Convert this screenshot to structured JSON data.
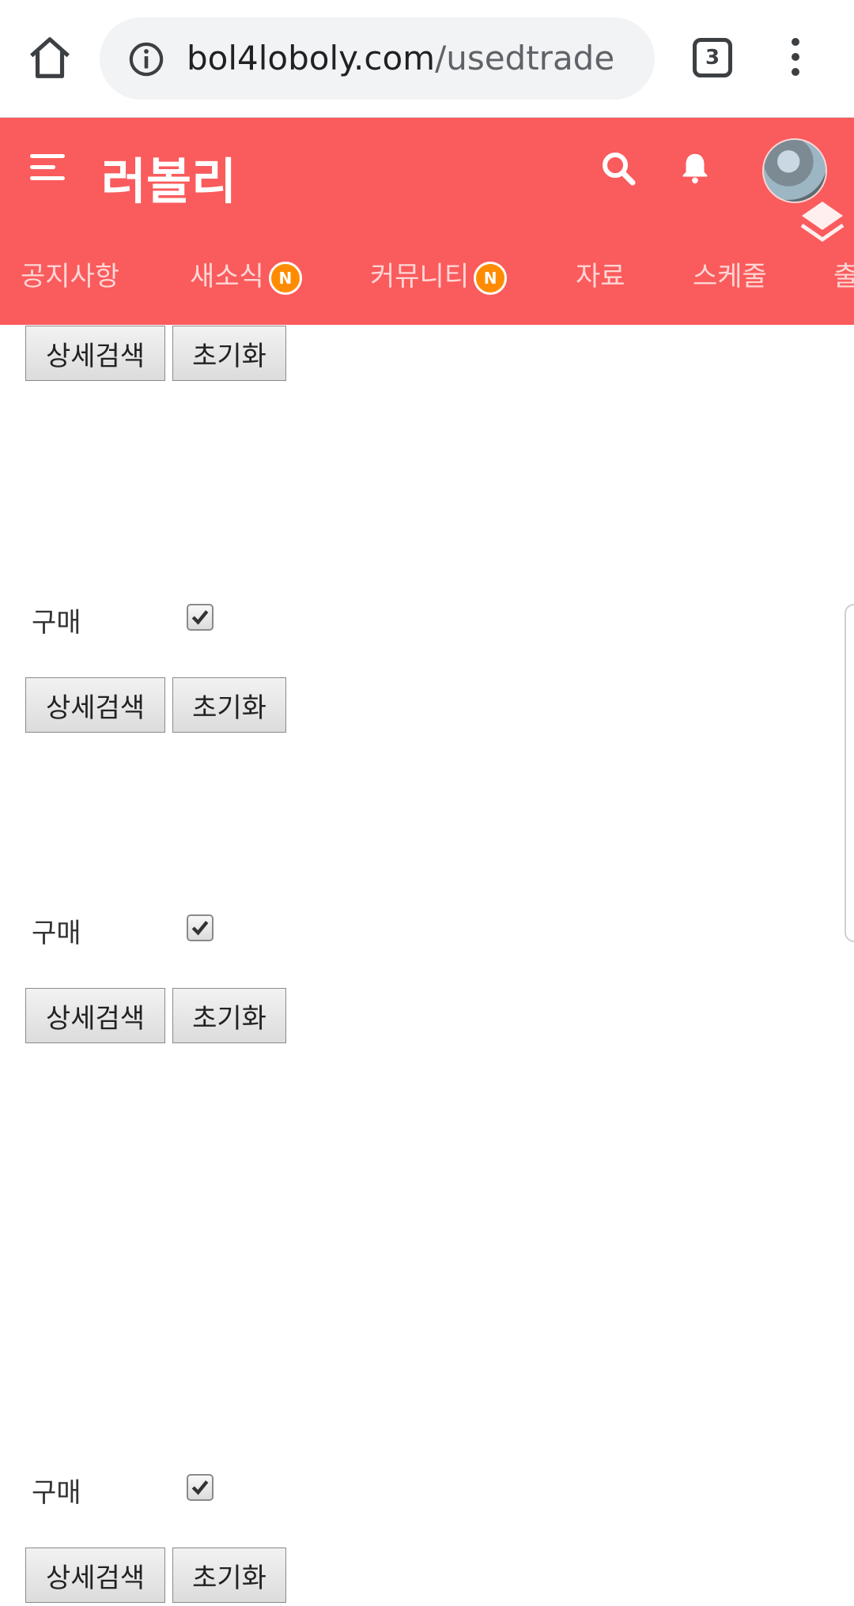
{
  "browser": {
    "url_domain": "bol4loboly.com",
    "url_path": "/usedtrade",
    "tab_count": "3"
  },
  "site": {
    "title": "러볼리",
    "nav": [
      {
        "label": "공지사항",
        "badge": ""
      },
      {
        "label": "새소식",
        "badge": "N"
      },
      {
        "label": "커뮤니티",
        "badge": "N"
      },
      {
        "label": "자료",
        "badge": ""
      },
      {
        "label": "스케줄",
        "badge": ""
      },
      {
        "label": "출",
        "badge": ""
      }
    ]
  },
  "filters": {
    "detail_search_label": "상세검색",
    "reset_label": "초기화",
    "purchase_label": "구매",
    "purchase_checked": true
  },
  "colors": {
    "header_bg": "#fa5b5c",
    "badge": "#ff8c00"
  }
}
